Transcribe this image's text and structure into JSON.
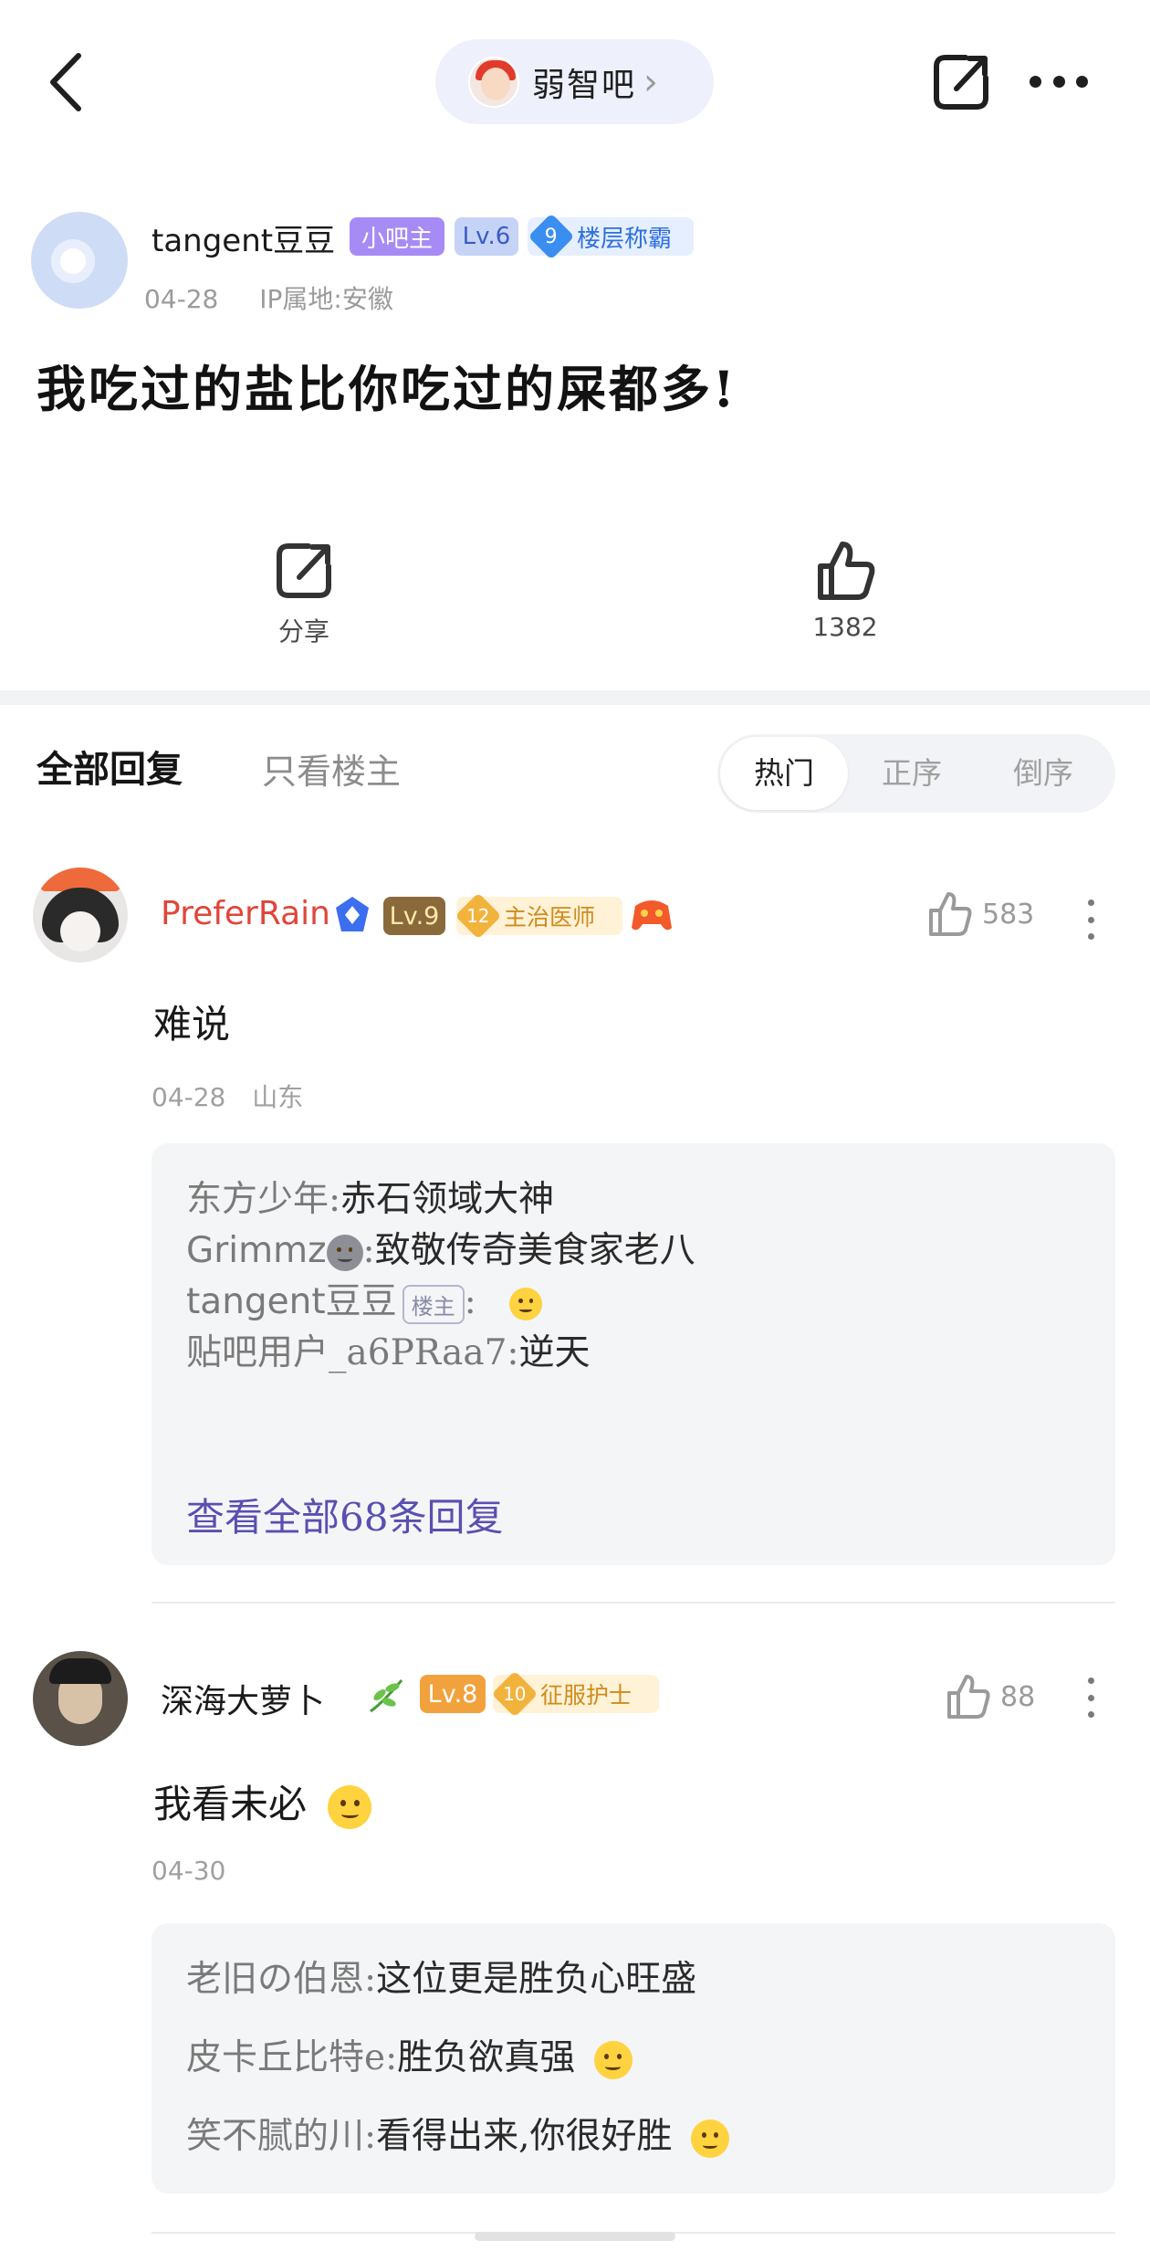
{
  "topbar": {
    "forum_name": "弱智吧",
    "forum_chevron": "›"
  },
  "post": {
    "author": "tangent豆豆",
    "badges": {
      "owner": "小吧主",
      "level": "Lv.6",
      "floor_num": "9",
      "floor_title": "楼层称霸"
    },
    "date": "04-28",
    "ip": "IP属地:安徽",
    "title": "我吃过的盐比你吃过的屎都多!",
    "actions": {
      "share_label": "分享",
      "like_count": "1382"
    }
  },
  "replies_header": {
    "tab_all": "全部回复",
    "tab_op_only": "只看楼主",
    "sort": [
      "热门",
      "正序",
      "倒序"
    ]
  },
  "comments": [
    {
      "name": "PreferRain",
      "level": "Lv.9",
      "title_num": "12",
      "title": "主治医师",
      "like_count": "583",
      "body": "难说",
      "date": "04-28",
      "location": "山东",
      "subreplies": [
        {
          "who": "东方少年",
          "sep": ":",
          "text": "赤石领域大神"
        },
        {
          "who": "Grimmz",
          "sep": ":",
          "text": "致敬传奇美食家老八"
        },
        {
          "who": "tangent豆豆",
          "tag": "楼主",
          "sep": ":",
          "text": ""
        },
        {
          "who": "贴吧用户_a6PRaa7",
          "sep": ":",
          "text": "逆天"
        }
      ],
      "view_all": "查看全部68条回复"
    },
    {
      "name": "深海大萝卜",
      "level": "Lv.8",
      "title_num": "10",
      "title": "征服护士",
      "like_count": "88",
      "body": "我看未必",
      "date": "04-30",
      "subreplies": [
        {
          "who": "老旧の伯恩",
          "sep": ":",
          "text": "这位更是胜负心旺盛"
        },
        {
          "who": "皮卡丘比特e",
          "sep": ":",
          "text": "胜负欲真强"
        },
        {
          "who": "笑不腻的川",
          "sep": ":",
          "text": "看得出来,你很好胜"
        }
      ]
    }
  ],
  "colors": {
    "accent_purple": "#5a4fb0",
    "vip_red": "#e0463a",
    "owner_badge": "#a78bf5"
  },
  "icons": [
    "back-icon",
    "share-icon",
    "more-icon",
    "like-icon",
    "vip-icon",
    "game-icon",
    "leaf-icon",
    "emoji-icon"
  ]
}
